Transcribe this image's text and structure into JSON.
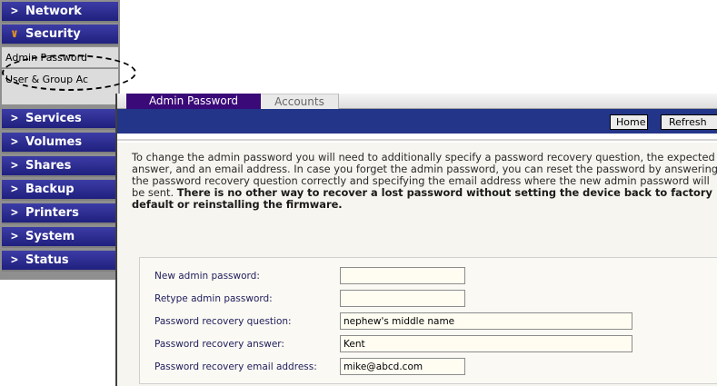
{
  "nav": {
    "items": [
      {
        "label": "Network",
        "chevron": ">"
      },
      {
        "label": "Security",
        "chevron": "∨",
        "expanded": true
      },
      {
        "label": "Services",
        "chevron": ">"
      },
      {
        "label": "Volumes",
        "chevron": ">"
      },
      {
        "label": "Shares",
        "chevron": ">"
      },
      {
        "label": "Backup",
        "chevron": ">"
      },
      {
        "label": "Printers",
        "chevron": ">"
      },
      {
        "label": "System",
        "chevron": ">"
      },
      {
        "label": "Status",
        "chevron": ">"
      }
    ],
    "subitems": [
      {
        "label": "Admin Password"
      },
      {
        "label": "User & Group Ac"
      }
    ]
  },
  "tabs": [
    {
      "label": "Admin Password",
      "active": true
    },
    {
      "label": "Accounts",
      "active": false
    }
  ],
  "header": {
    "home_label": "Home",
    "refresh_label": "Refresh"
  },
  "intro": {
    "text": "To change the admin password you will need to additionally specify a password recovery question, the expected answer, and an email address. In case you forget the admin password, you can reset the password by answering the password recovery question correctly and specifying the email address where the new admin password will be sent. ",
    "bold": "There is no other way to recover a lost password without setting the device back to factory default or reinstalling the firmware."
  },
  "form": {
    "fields": [
      {
        "label": "New admin password:",
        "value": ""
      },
      {
        "label": "Retype admin password:",
        "value": ""
      },
      {
        "label": "Password recovery question:",
        "value": "nephew's middle name"
      },
      {
        "label": "Password recovery answer:",
        "value": "Kent"
      },
      {
        "label": "Password recovery email address:",
        "value": "mike@abcd.com"
      }
    ]
  },
  "colors": {
    "nav_bg": "#20207e",
    "expanded_chevron": "#f39a18",
    "active_tab": "#3a0a78",
    "header_bar": "#223588",
    "content_bg": "#f7f5ef"
  }
}
